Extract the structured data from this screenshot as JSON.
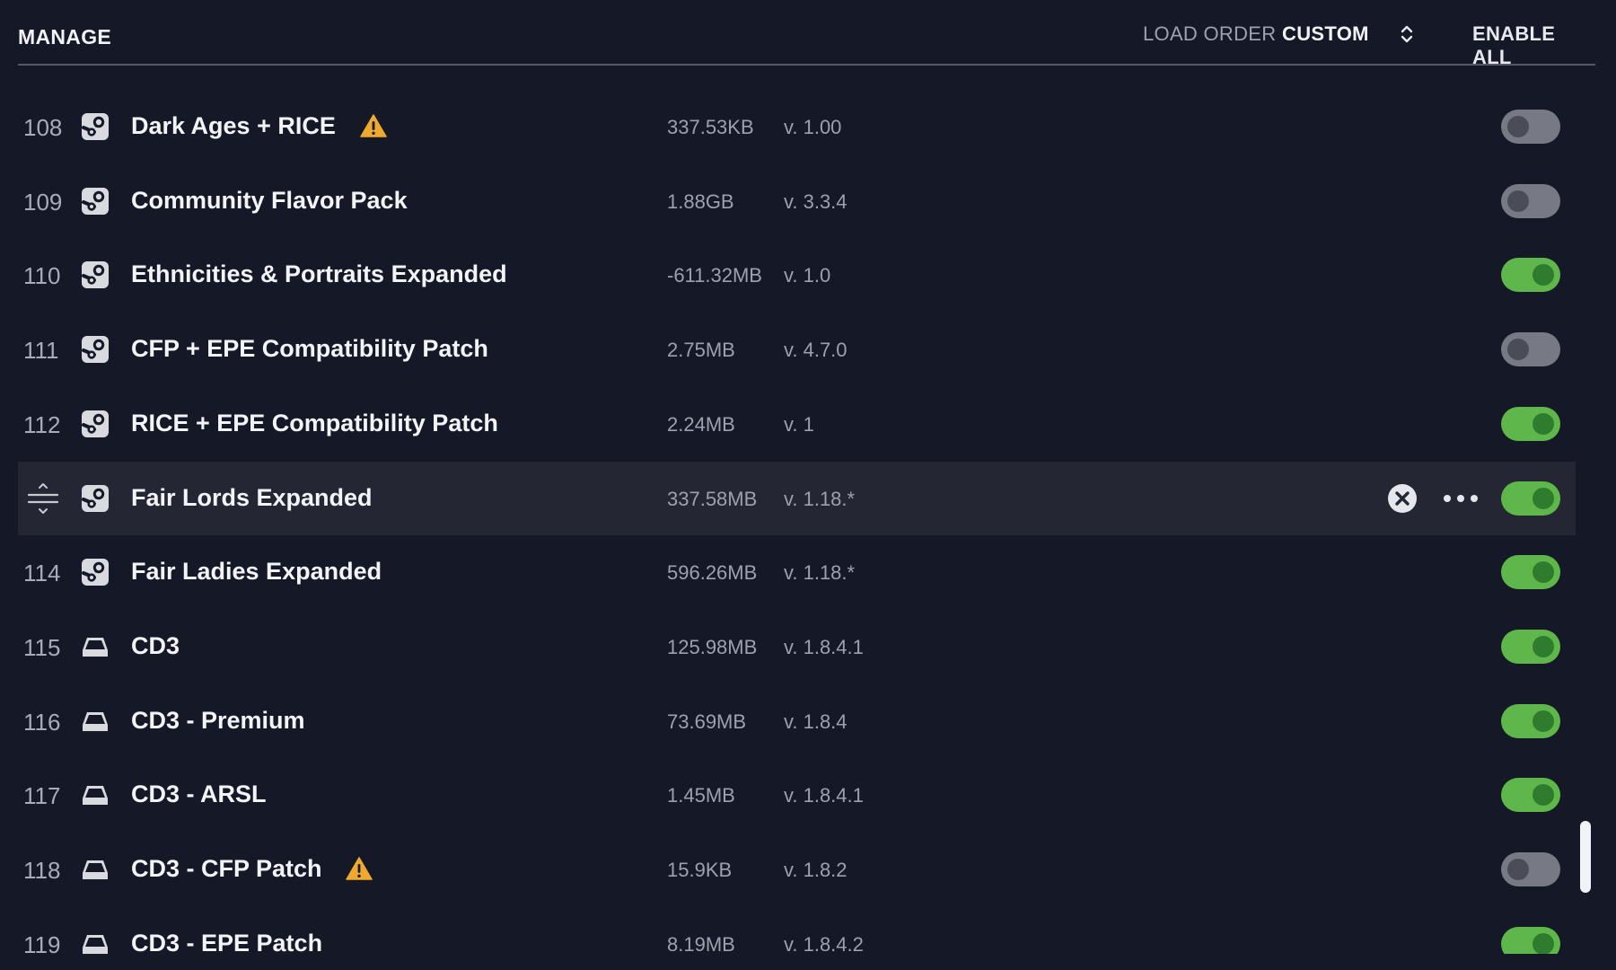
{
  "header": {
    "title": "MANAGE",
    "load_order_label": "LOAD ORDER",
    "load_order_value": "CUSTOM",
    "enable_all": "ENABLE ALL"
  },
  "colors": {
    "background": "#151826",
    "selected_row": "#242733",
    "toggle_on": "#5fb64a",
    "toggle_off": "#777a84",
    "warning": "#f0a92f"
  },
  "mods": [
    {
      "num": "108",
      "source": "steam-icon",
      "name": "Dark Ages + RICE",
      "warning": true,
      "size": "337.53KB",
      "version": "v. 1.00",
      "enabled": false,
      "selected": false
    },
    {
      "num": "109",
      "source": "steam-icon",
      "name": "Community Flavor Pack",
      "warning": false,
      "size": "1.88GB",
      "version": "v. 3.3.4",
      "enabled": false,
      "selected": false
    },
    {
      "num": "110",
      "source": "steam-icon",
      "name": "Ethnicities & Portraits Expanded",
      "warning": false,
      "size": "-611.32MB",
      "version": "v. 1.0",
      "enabled": true,
      "selected": false
    },
    {
      "num": "111",
      "source": "steam-icon",
      "name": "CFP + EPE Compatibility Patch",
      "warning": false,
      "size": "2.75MB",
      "version": "v. 4.7.0",
      "enabled": false,
      "selected": false
    },
    {
      "num": "112",
      "source": "steam-icon",
      "name": "RICE + EPE Compatibility Patch",
      "warning": false,
      "size": "2.24MB",
      "version": "v. 1",
      "enabled": true,
      "selected": false
    },
    {
      "num": "",
      "source": "steam-icon",
      "name": "Fair Lords Expanded",
      "warning": false,
      "size": "337.58MB",
      "version": "v. 1.18.*",
      "enabled": true,
      "selected": true
    },
    {
      "num": "114",
      "source": "steam-icon",
      "name": "Fair Ladies Expanded",
      "warning": false,
      "size": "596.26MB",
      "version": "v. 1.18.*",
      "enabled": true,
      "selected": false
    },
    {
      "num": "115",
      "source": "local-drive-icon",
      "name": "CD3",
      "warning": false,
      "size": "125.98MB",
      "version": "v. 1.8.4.1",
      "enabled": true,
      "selected": false
    },
    {
      "num": "116",
      "source": "local-drive-icon",
      "name": "CD3 - Premium",
      "warning": false,
      "size": "73.69MB",
      "version": "v. 1.8.4",
      "enabled": true,
      "selected": false
    },
    {
      "num": "117",
      "source": "local-drive-icon",
      "name": "CD3 - ARSL",
      "warning": false,
      "size": "1.45MB",
      "version": "v. 1.8.4.1",
      "enabled": true,
      "selected": false
    },
    {
      "num": "118",
      "source": "local-drive-icon",
      "name": "CD3 - CFP Patch",
      "warning": true,
      "size": "15.9KB",
      "version": "v. 1.8.2",
      "enabled": false,
      "selected": false
    },
    {
      "num": "119",
      "source": "local-drive-icon",
      "name": "CD3 - EPE Patch",
      "warning": false,
      "size": "8.19MB",
      "version": "v. 1.8.4.2",
      "enabled": true,
      "selected": false
    }
  ]
}
